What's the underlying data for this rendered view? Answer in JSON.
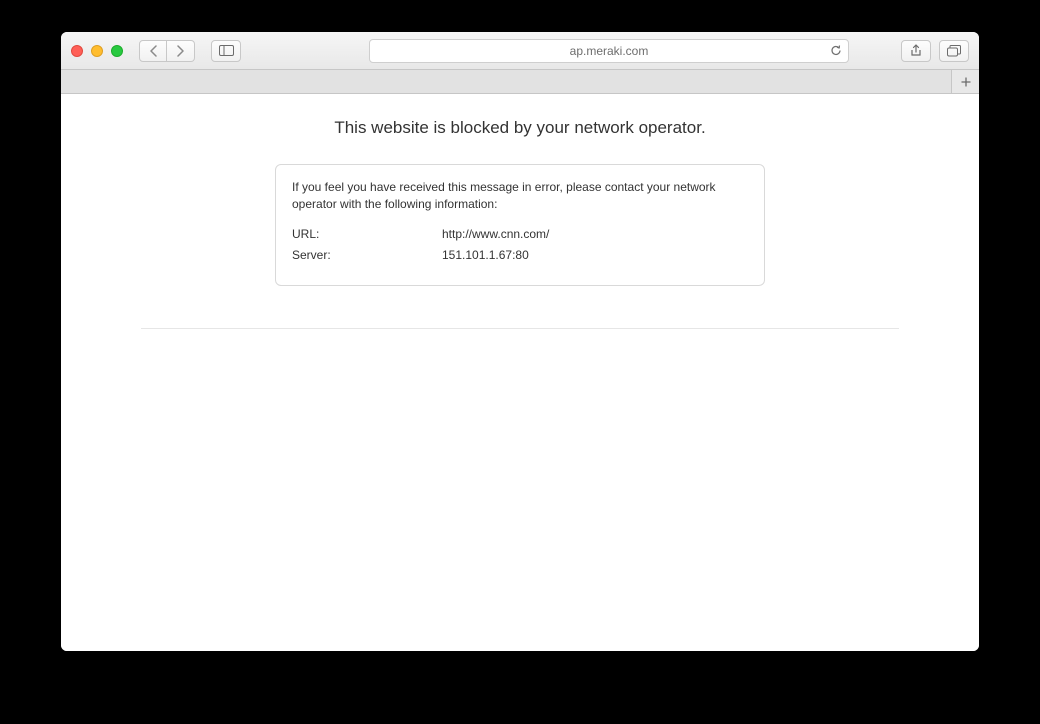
{
  "addressbar": {
    "url_display": "ap.meraki.com"
  },
  "page": {
    "heading": "This website is blocked by your network operator.",
    "instruction": "If you feel you have received this message in error, please contact your network operator with the following information:",
    "url_label": "URL:",
    "url_value": "http://www.cnn.com/",
    "server_label": "Server:",
    "server_value": "151.101.1.67:80"
  }
}
